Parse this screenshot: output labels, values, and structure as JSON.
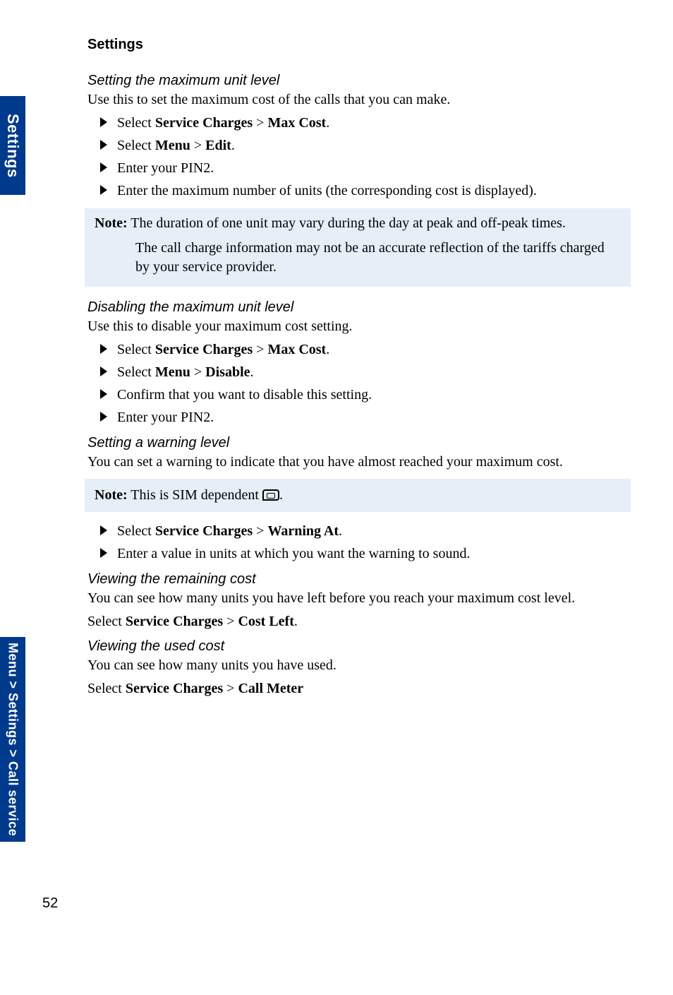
{
  "page": {
    "number": "52",
    "sideTabTop": "Settings",
    "sideTabBottom": "Menu > Settings > Call service",
    "heading": "Settings"
  },
  "sec1": {
    "title": "Setting the maximum unit level",
    "intro": "Use this to set the maximum cost of the calls that you can make.",
    "step1_pre": "Select ",
    "step1_b1": "Service Charges",
    "step1_sep": " > ",
    "step1_b2": "Max Cost",
    "step1_post": ".",
    "step2_pre": "Select ",
    "step2_b1": "Menu",
    "step2_sep": " > ",
    "step2_b2": "Edit",
    "step2_post": ".",
    "step3": "Enter your PIN2.",
    "step4": "Enter the maximum number of units (the corresponding cost is displayed)."
  },
  "note1": {
    "label": "Note:",
    "line1": " The duration of one unit may vary during the day at peak and off-peak times.",
    "line2": "The call charge information may not be an accurate reflection of the tariffs charged by your service provider."
  },
  "sec2": {
    "title": "Disabling the maximum unit level",
    "intro": "Use this to disable your maximum cost setting.",
    "step1_pre": "Select ",
    "step1_b1": "Service Charges",
    "step1_sep": " > ",
    "step1_b2": "Max Cost",
    "step1_post": ".",
    "step2_pre": "Select ",
    "step2_b1": "Menu",
    "step2_sep": " > ",
    "step2_b2": "Disable",
    "step2_post": ".",
    "step3": "Confirm that you want to disable this setting.",
    "step4": "Enter your PIN2."
  },
  "sec3": {
    "title": "Setting a warning level",
    "intro": "You can set a warning to indicate that you have almost reached your maximum cost."
  },
  "note2": {
    "label": "Note:",
    "text": " This is SIM dependent ",
    "post": "."
  },
  "sec3b": {
    "step1_pre": "Select ",
    "step1_b1": "Service Charges",
    "step1_sep": " > ",
    "step1_b2": "Warning At",
    "step1_post": ".",
    "step2": "Enter a value in units at which you want the warning to sound."
  },
  "sec4": {
    "title": "Viewing the remaining cost",
    "intro": "You can see how many units you have left before you reach your maximum cost level.",
    "action_pre": "Select ",
    "action_b1": "Service Charges",
    "action_sep": " > ",
    "action_b2": "Cost Left",
    "action_post": "."
  },
  "sec5": {
    "title": "Viewing the used cost",
    "intro": "You can see how many units you have used.",
    "action_pre": "Select ",
    "action_b1": "Service Charges",
    "action_sep": " > ",
    "action_b2": "Call Meter"
  }
}
